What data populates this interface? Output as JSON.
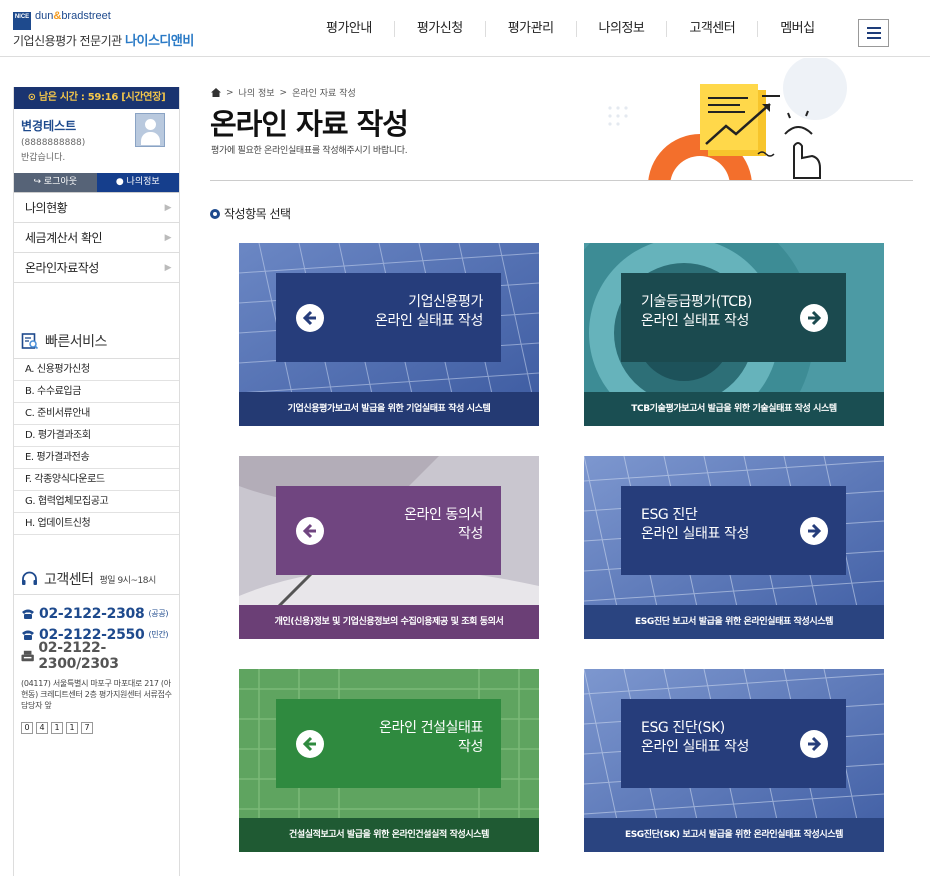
{
  "header": {
    "logo": {
      "mark": "NICE",
      "brand_prefix": "dun",
      "brand_amp": "&",
      "brand_suffix": "bradstreet",
      "subtitle": "기업신용평가 전문기관",
      "company": "나이스디앤비"
    },
    "nav": [
      "평가안내",
      "평가신청",
      "평가관리",
      "나의정보",
      "고객센터",
      "멤버십"
    ],
    "menu_icon": "hamburger-icon"
  },
  "sidebar": {
    "timer": "⊙ 남은 시간 : 59:16 [시간연장]",
    "user_name": "변경테스트",
    "user_id": "(8888888888)",
    "greeting": "반갑습니다.",
    "logout_label": "↪ 로그아웃",
    "myinfo_label": "● 나의정보",
    "menu": [
      "나의현황",
      "세금계산서 확인",
      "온라인자료작성"
    ],
    "quick_title": "빠른서비스",
    "quick_items": [
      "A. 신용평가신청",
      "B. 수수료입금",
      "C. 준비서류안내",
      "D. 평가결과조회",
      "E. 평가결과전송",
      "F. 각종양식다운로드",
      "G. 협력업체모집공고",
      "H. 업데이트신청"
    ],
    "cs_title": "고객센터",
    "cs_hours": "평일 9시~18시",
    "phones": [
      {
        "number": "02-2122-2308",
        "note": "(공공)"
      },
      {
        "number": "02-2122-2550",
        "note": "(민간)"
      }
    ],
    "fax": "02-2122-2300/2303",
    "address": "(04117) 서울특별시 마포구 마포대로 217 (아현동) 크레디트센터 2층 평가지원센터 서류접수담당자 앞",
    "postal_digits": [
      "0",
      "4",
      "1",
      "1",
      "7"
    ]
  },
  "main": {
    "breadcrumb": [
      "나의 정보",
      "온라인 자료 작성"
    ],
    "title": "온라인 자료 작성",
    "description": "평가에 필요한 온라인실태표를 작성해주시기 바랍니다.",
    "section_label": "작성항목 선택",
    "cards": [
      {
        "line1": "기업신용평가",
        "line2": "온라인 실태표 작성",
        "footer": "기업신용평가보고서 발급을 위한 기업실태표 작성 시스템"
      },
      {
        "line1": "기술등급평가(TCB)",
        "line2": "온라인 실태표 작성",
        "footer": "TCB기술평가보고서 발급을 위한 기술실태표 작성 시스템"
      },
      {
        "line1": "온라인 동의서",
        "line2": "작성",
        "footer": "개인(신용)정보 및 기업신용정보의 수집이용제공 및 조회 동의서"
      },
      {
        "line1": "ESG 진단",
        "line2": "온라인 실태표 작성",
        "footer": "ESG진단 보고서 발급을 위한 온라인실태표 작성시스템"
      },
      {
        "line1": "온라인 건설실태표",
        "line2": "작성",
        "footer": "건설실적보고서 발급을 위한 온라인건설실적 작성시스템"
      },
      {
        "line1": "ESG 진단(SK)",
        "line2": "온라인 실태표 작성",
        "footer": "ESG진단(SK) 보고서 발급을 위한 온라인실태표 작성시스템"
      }
    ]
  },
  "colors": {
    "navy": "#1e4a8d",
    "timer_bg": "#1a3470",
    "card_blue": "#2b3f7a",
    "card_teal": "#1f4f57",
    "card_purple": "#6a3f78",
    "card_green": "#2f7a3d"
  }
}
